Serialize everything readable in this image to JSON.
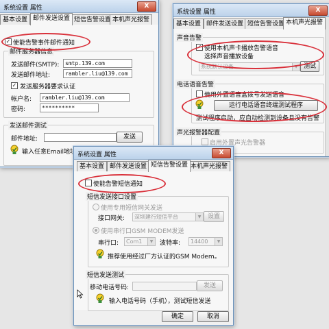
{
  "window1": {
    "title": "系统设置 属性",
    "close": "X",
    "tabs": [
      "基本设置",
      "邮件发送设置",
      "短信告警设置",
      "本机声光报警"
    ],
    "enable_email_label": "使能告警事件邮件通知",
    "server_group_label": "邮件服务器信息",
    "smtp_label": "发送邮件(SMTP):",
    "smtp_value": "smtp.139.com",
    "sender_label": "发送邮件地址:",
    "sender_value": "rambler.liu@139.com",
    "auth_label": "发送服务器要求认证",
    "account_label": "帐户名:",
    "account_value": "rambler.liu@139.com",
    "password_label": "密码:",
    "password_value": "**********",
    "test_group_label": "发送邮件测试",
    "test_address_label": "邮件地址:",
    "send_button": "发送",
    "hint": "输入任意Email地址，测试邮件服务器配置"
  },
  "window2": {
    "title": "系统设置 属性",
    "close": "X",
    "tabs": [
      "基本设置",
      "邮件发送设置",
      "短信告警设置",
      "本机声光报警"
    ],
    "sound_group_label": "声音告警",
    "use_sound_card_label": "使用本机声卡播放告警语音",
    "select_device_label": "选择声音播放设备",
    "device_value": "系统默认设备",
    "test_button": "测试",
    "phone_group_label": "电话语音告警",
    "use_voice_box_label": "使用外置语音盒拨号发送语音",
    "run_test_button": "运行电话语音终端测试程序",
    "test_hint": "测试程序启动，应自动检测到设备且没有告警",
    "light_group_label": "声光报警器配置",
    "use_alarm_label": "启用外置声光告警器"
  },
  "window3": {
    "title": "系统设置 属性",
    "close": "X",
    "tabs": [
      "基本设置",
      "邮件发送设置",
      "短信告警设置",
      "本机声光报警"
    ],
    "enable_sms_label": "使能告警短信通知",
    "sms_group_label": "短信发送接口设置",
    "gateway_radio_label": "使用专用短信网关发送",
    "gateway_label": "接口网关:",
    "gateway_value": "深圳建行短信平台",
    "settings_button": "设置",
    "gsm_radio_label": "使用串行口GSM MODEM发送",
    "port_label": "串行口:",
    "port_value": "Com1",
    "baud_label": "波特率:",
    "baud_value": "14400",
    "gsm_hint": "推荐使用经过厂方认证的GSM Modem。",
    "sms_test_group_label": "短信发送测试",
    "mobile_label": "移动电话号码:",
    "send_button": "发送",
    "mobile_hint": "输入电话号码（手机），测试短信发送",
    "ok_button": "确定",
    "cancel_button": "取消"
  },
  "colors": {
    "highlight": "#d9303a",
    "title_bar": "#bcd2ea",
    "dialog_bg": "#f0f0f0"
  },
  "icons": [
    "lightbulb-icon",
    "checkmark-icon",
    "mouse-pointer-icon"
  ]
}
